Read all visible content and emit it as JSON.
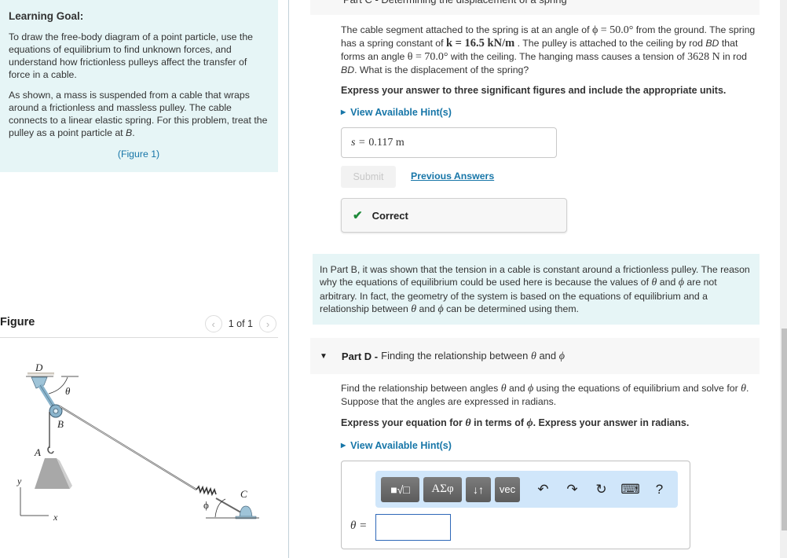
{
  "learning_goal": {
    "title": "Learning Goal:",
    "paragraph1": "To draw the free-body diagram of a point particle, use the equations of equilibrium to find unknown forces, and understand how frictionless pulleys affect the transfer of force in a cable.",
    "paragraph2_pre": "As shown, a mass is suspended from a cable that wraps around a frictionless and massless pulley. The cable connects to a linear elastic spring. For this problem, treat the pulley as a point particle at ",
    "paragraph2_point": "B",
    "paragraph2_end": ".",
    "figure_link": "(Figure 1)"
  },
  "figure": {
    "title": "Figure",
    "prev_icon": "‹",
    "next_icon": "›",
    "counter": "1 of 1",
    "labels": {
      "D": "D",
      "B": "B",
      "A": "A",
      "C": "C",
      "theta": "θ",
      "phi": "ϕ",
      "y": "y",
      "x": "x"
    }
  },
  "part_c": {
    "header_partial": "Part C - Determining the displacement of a spring",
    "problem": {
      "t1": "The cable segment attached to the spring is at an angle of ",
      "phi_eq": "ϕ = 50.0°",
      "t2": " from the ground. The spring has a spring constant of ",
      "k_eq": "k = 16.5 kN/m",
      "t3": " . The pulley is attached to the ceiling by rod ",
      "rod1": "BD",
      "t4": " that forms an angle ",
      "theta_eq": "θ = 70.0°",
      "t5": " with the ceiling. The hanging mass causes a tension of ",
      "tension": "3628 N",
      "t6": " in rod ",
      "rod2": "BD",
      "t7": ". What is the displacement of the spring?"
    },
    "instruction": "Express your answer to three significant figures and include the appropriate units.",
    "hint_label": "View Available Hint(s)",
    "answer_var": "s =",
    "answer_value": "0.117 m",
    "submit_label": "Submit",
    "previous_answers_label": "Previous Answers",
    "result_label": "Correct"
  },
  "info": {
    "t1": "In Part B, it was shown that the tension in a cable is constant around a frictionless pulley. The reason why the equations of equilibrium could be used here is because the values of ",
    "theta": "θ",
    "t2": " and ",
    "phi": "ϕ",
    "t3": " are not arbitrary. In fact, the geometry of the system is based on the equations of equilibrium and a relationship between ",
    "t4": " and ",
    "t5": " can be determined using them."
  },
  "part_d": {
    "label": "Part D -",
    "title_pre": "Finding the relationship between ",
    "theta": "θ",
    "and": " and ",
    "phi": "ϕ",
    "q1": "Find the relationship between angles ",
    "q2": " and ",
    "q3": " using the equations of equilibrium and solve for ",
    "q4": ". Suppose that the angles are expressed in radians.",
    "inst1": "Express your equation for ",
    "inst2": " in terms of ",
    "inst3": ". Express your answer in radians.",
    "hint_label": "View Available Hint(s)",
    "toolbar": {
      "templates": "■√□",
      "greek": "ΑΣφ",
      "arrows": "↓↑",
      "vec": "vec",
      "undo": "↶",
      "redo": "↷",
      "reset": "↻",
      "keyboard": "⌨",
      "help": "?"
    },
    "input_label": "θ =",
    "input_value": ""
  }
}
